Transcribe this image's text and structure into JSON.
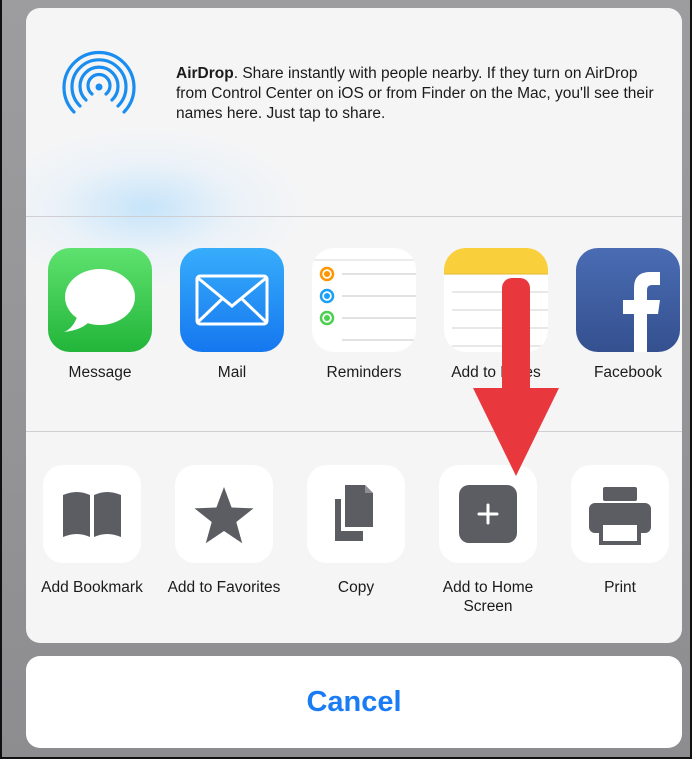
{
  "airdrop": {
    "title": "AirDrop",
    "text": ". Share instantly with people nearby. If they turn on AirDrop from Control Center on iOS or from Finder on the Mac, you'll see their names here. Just tap to share."
  },
  "apps": [
    {
      "label": "Message",
      "icon": "messages-icon"
    },
    {
      "label": "Mail",
      "icon": "mail-icon"
    },
    {
      "label": "Reminders",
      "icon": "reminders-icon"
    },
    {
      "label": "Add to Notes",
      "icon": "notes-icon"
    },
    {
      "label": "Facebook",
      "icon": "facebook-icon"
    }
  ],
  "actions": [
    {
      "label": "Add Bookmark",
      "icon": "book-icon"
    },
    {
      "label": "Add to Favorites",
      "icon": "star-icon"
    },
    {
      "label": "Copy",
      "icon": "copy-icon"
    },
    {
      "label": "Add to Home Screen",
      "icon": "add-square-icon"
    },
    {
      "label": "Print",
      "icon": "printer-icon"
    }
  ],
  "cancel": {
    "label": "Cancel"
  },
  "colors": {
    "accent": "#1a7cf5",
    "arrow": "#e8383d",
    "airdrop": "#1a8df0",
    "messages": "#35c64b",
    "mail": "#1d8cf8",
    "facebook": "#3b5998",
    "notes_top": "#f9cf3b"
  }
}
